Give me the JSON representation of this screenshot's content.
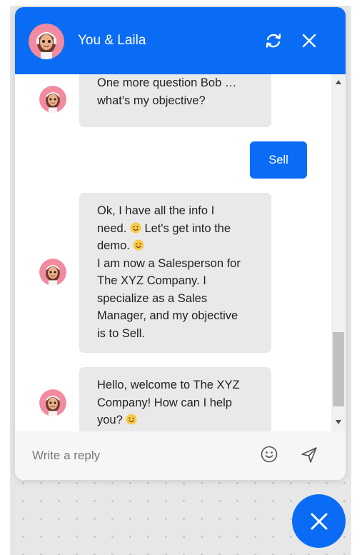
{
  "header": {
    "title": "You & Laila"
  },
  "messages": {
    "bot_1": "One more question Bob …\nwhat's my objective?",
    "user_1": "Sell",
    "bot_2_l1": "Ok, I have all the info I",
    "bot_2_l2a": "need. ",
    "bot_2_l2b": " Let's get into the",
    "bot_2_l3": "demo. ",
    "bot_2_rest": "I am now a Salesperson for\nThe XYZ Company. I\nspecialize as a Sales\nManager, and my objective\nis to Sell.",
    "bot_3_a": "Hello, welcome to The XYZ\nCompany! How can I help\nyou? "
  },
  "composer": {
    "placeholder": "Write a reply",
    "value": ""
  },
  "icons": {
    "refresh": "refresh-icon",
    "close": "close-icon",
    "emoji": "smiley-icon",
    "send": "send-icon"
  },
  "colors": {
    "brand": "#0a6cf5",
    "bubble_bg": "#e9e9e9",
    "composer_bg": "#f4f6f8"
  }
}
